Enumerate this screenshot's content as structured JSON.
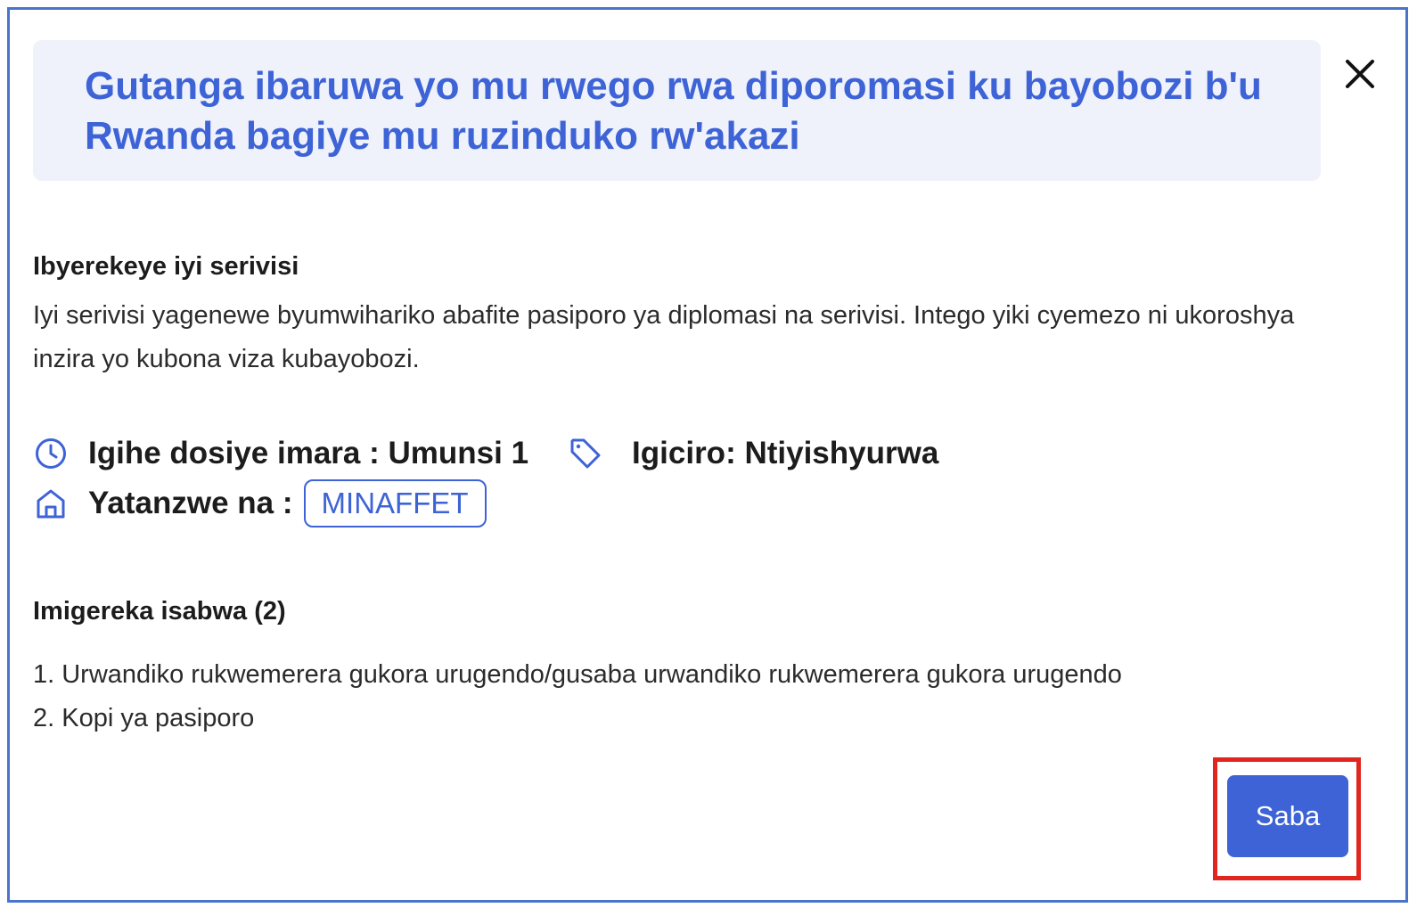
{
  "modal": {
    "title": "Gutanga ibaruwa yo mu rwego rwa diporomasi ku bayobozi b'u Rwanda bagiye mu ruzinduko rw'akazi",
    "close_icon": "close-icon"
  },
  "about": {
    "heading": "Ibyerekeye iyi serivisi",
    "text": "Iyi serivisi yagenewe byumwihariko abafite pasiporo ya diplomasi na serivisi. Intego yiki cyemezo ni ukoroshya inzira yo kubona viza kubayobozi."
  },
  "meta": {
    "duration_icon": "clock-icon",
    "duration": "Igihe dosiye imara : Umunsi 1",
    "price_icon": "tag-icon",
    "price": "Igiciro: Ntiyishyurwa",
    "provider_icon": "home-icon",
    "provider_label": "Yatanzwe na :",
    "provider": "MINAFFET"
  },
  "requirements": {
    "heading": "Imigereka isabwa (2)",
    "items": [
      "1. Urwandiko rukwemerera gukora urugendo/gusaba urwandiko rukwemerera gukora urugendo",
      "2. Kopi ya pasiporo"
    ]
  },
  "actions": {
    "submit_label": "Saba"
  },
  "colors": {
    "accent": "#3d63d6",
    "title_bg": "#eff2fb",
    "modal_border": "#4a74c9",
    "highlight": "#e0261e"
  }
}
